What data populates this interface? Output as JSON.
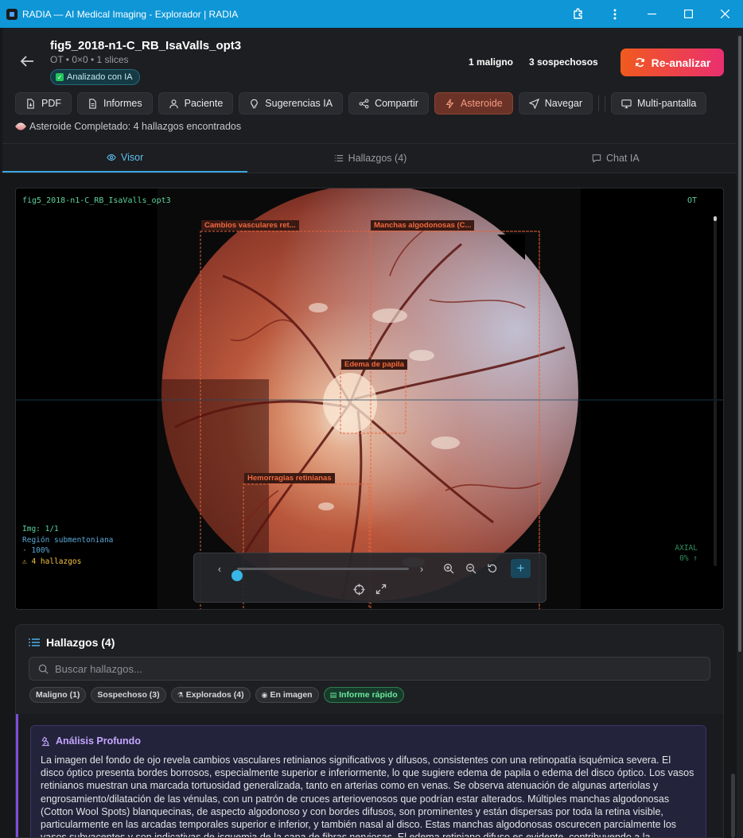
{
  "window": {
    "title": "RADIA — AI Medical Imaging - Explorador | RADIA"
  },
  "file": {
    "name": "fig5_2018-n1-C_RB_IsaValls_opt3",
    "meta": "OT • 0×0 • 1 slices",
    "ai_badge": "Analizado con IA"
  },
  "counts": {
    "malignant": "1 maligno",
    "suspicious": "3 sospechosos"
  },
  "reanalyze_label": "Re-analizar",
  "toolbar": {
    "pdf": "PDF",
    "reports": "Informes",
    "patient": "Paciente",
    "ai_suggestions": "Sugerencias IA",
    "share": "Compartir",
    "asteroid": "Asteroide",
    "navigate": "Navegar",
    "multiscreen": "Multi-pantalla"
  },
  "status": "Asteroide Completado: 4 hallazgos encontrados",
  "tabs": {
    "viewer": "Visor",
    "findings": "Hallazgos (4)",
    "chat": "Chat IA"
  },
  "viewer": {
    "filename": "fig5_2018-n1-C_RB_IsaValls_opt3",
    "modality": "OT",
    "img_counter": "Img: 1/1",
    "region": "Región submentoniana",
    "zoom": "· 100%",
    "findings_count": "⚠ 4 hallazgos",
    "axial": "AXIAL",
    "axial_pct": "0% ↑",
    "slice_position": 0.0,
    "annotations": {
      "a1": "Cambios vasculares ret...",
      "a2": "Manchas algodonosas (C...",
      "a3": "Edema de papila",
      "a4": "Hemorragias retinianas"
    }
  },
  "findings_panel": {
    "title": "Hallazgos (4)",
    "search_placeholder": "Buscar hallazgos...",
    "chips": {
      "malignant": "Maligno (1)",
      "suspicious": "Sospechoso (3)",
      "explored": "Explorados (4)",
      "in_image": "En imagen",
      "quick_report": "Informe rápido"
    },
    "deep_title": "Análisis Profundo",
    "deep_text": "La imagen del fondo de ojo revela cambios vasculares retinianos significativos y difusos, consistentes con una retinopatía isquémica severa. El disco óptico presenta bordes borrosos, especialmente superior e inferiormente, lo que sugiere edema de papila o edema del disco óptico. Los vasos retinianos muestran una marcada tortuosidad generalizada, tanto en arterias como en venas. Se observa atenuación de algunas arteriolas y engrosamiento/dilatación de las vénulas, con un patrón de cruces arteriovenosos que podrían estar alterados. Múltiples manchas algodonosas (Cotton Wool Spots) blanquecinas, de aspecto algodonoso y con bordes difusos, son prominentes y están dispersas por toda la retina visible, particularmente en las arcadas temporales superior e inferior, y también nasal al disco. Estas manchas algodonosas oscurecen parcialmente los vasos subyacentes y son indicativas de isquemia de la capa de fibras nerviosas. El edema retiniano difuso es evidente, contribuyendo a la"
  },
  "colors": {
    "accent": "#3aa7e0",
    "reanalyze_start": "#f05a1e",
    "reanalyze_end": "#ea2f6f",
    "annotation": "#e8643a",
    "deep": "#7c4ed8"
  }
}
